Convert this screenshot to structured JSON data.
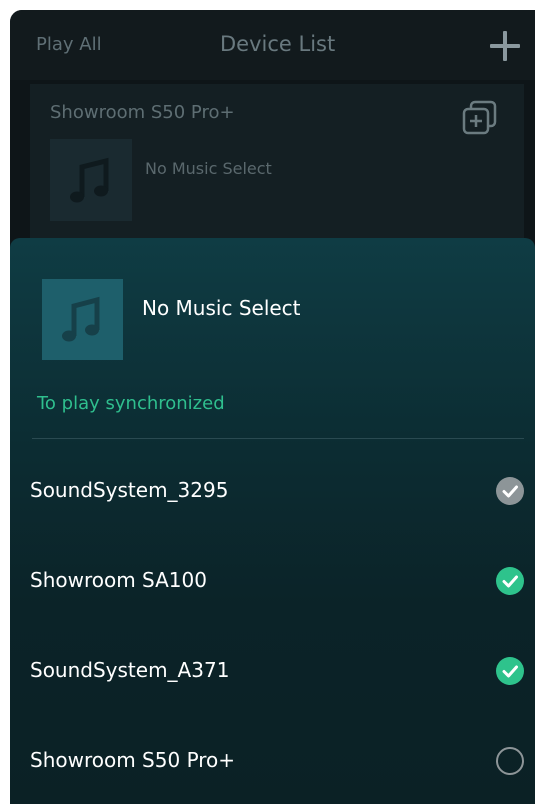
{
  "topbar": {
    "left_label": "Play All",
    "title": "Device List",
    "add_icon": "plus-icon"
  },
  "device_card": {
    "name": "Showroom S50 Pro+",
    "track": "No Music Select",
    "group_icon": "add-group-icon",
    "art_icon": "music-note-icon"
  },
  "sheet": {
    "track_title": "No Music Select",
    "art_icon": "music-note-icon",
    "sync_label": "To play synchronized",
    "devices": [
      {
        "name": "SoundSystem_3295",
        "state": "checked-grey"
      },
      {
        "name": "Showroom SA100",
        "state": "checked"
      },
      {
        "name": "SoundSystem_A371",
        "state": "checked"
      },
      {
        "name": "Showroom S50 Pro+",
        "state": "unchecked"
      }
    ]
  },
  "colors": {
    "accent_green": "#2ec38c",
    "sync_text": "#2fbf8e",
    "check_grey": "#8d9598"
  }
}
